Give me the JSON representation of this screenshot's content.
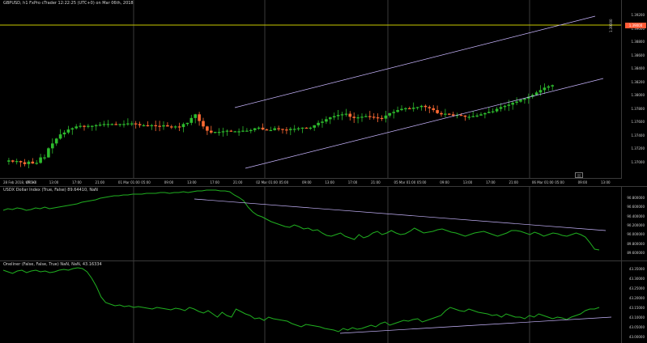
{
  "window": {
    "title": "GBPUSD, h1 FxPro cTrader 12:22:25 (UTC+0) on Mar 06th, 2018"
  },
  "colors": {
    "bull": "#2dbb2d",
    "bear": "#ff6a33",
    "line": "#20b020",
    "channel": "#c9b6ff",
    "grid": "#3a3a3a",
    "hline": "#c8c800",
    "text": "#d6d6d6",
    "price_tag": "#ff5a36"
  },
  "price_pane": {
    "axis_labels": [
      "1.39200",
      "1.39000",
      "1.38800",
      "1.38600",
      "1.38400",
      "1.38200",
      "1.38000",
      "1.37800",
      "1.37600",
      "1.37400",
      "1.37200",
      "1.37000"
    ],
    "current_price_tag": "1.39000",
    "vertical_note": "1.39000",
    "mini_control": "▯▯"
  },
  "time_axis": {
    "labels": [
      "28 Feb 2018, UTC+0",
      "09:00",
      "13:00",
      "17:00",
      "21:00",
      "01 Mar 01:00",
      "05:00",
      "09:00",
      "13:00",
      "17:00",
      "21:00",
      "02 Mar 01:00",
      "05:00",
      "09:00",
      "13:00",
      "17:00",
      "21:00",
      "05 Mar 01:00",
      "05:00",
      "09:00",
      "13:00",
      "17:00",
      "21:00",
      "06 Mar 01:00",
      "05:00",
      "09:00",
      "13:00"
    ]
  },
  "usdx_pane": {
    "title": "USDX Dollar Index (True, False) 89.64410, NaN",
    "axis_labels": [
      "90.800000",
      "90.600000",
      "90.400000",
      "90.200000",
      "90.000000",
      "89.800000",
      "89.600000"
    ]
  },
  "osc_pane": {
    "title": "Oneliner (False, False, True) NaN, NaN, 43.16334",
    "axis_labels": [
      "43.35000",
      "43.30000",
      "43.25000",
      "43.20000",
      "43.15000",
      "43.10000",
      "43.05000",
      "43.00000"
    ]
  }
}
